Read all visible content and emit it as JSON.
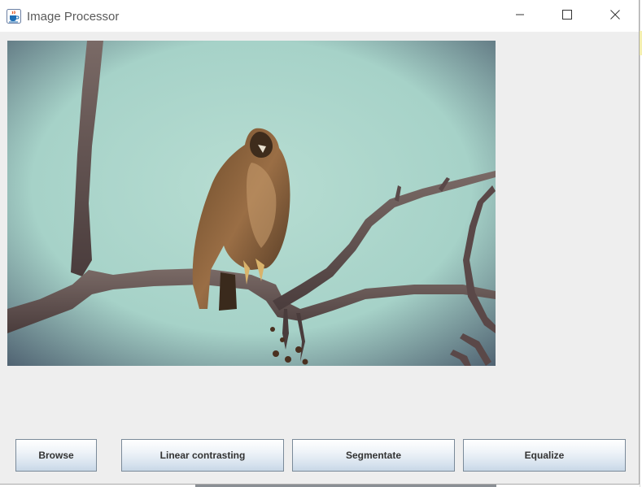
{
  "window": {
    "title": "Image Processor",
    "app_icon": "java-cup-icon",
    "controls": {
      "minimize_icon": "minimize-icon",
      "maximize_icon": "maximize-icon",
      "close_icon": "close-icon"
    }
  },
  "image": {
    "description_icon": "loaded-image"
  },
  "buttons": {
    "browse": "Browse",
    "linear_contrasting": "Linear contrasting",
    "segmentate": "Segmentate",
    "equalize": "Equalize"
  },
  "colors": {
    "window_bg": "#eeeeee",
    "titlebar_bg": "#ffffff",
    "button_border": "#7a8a99"
  }
}
